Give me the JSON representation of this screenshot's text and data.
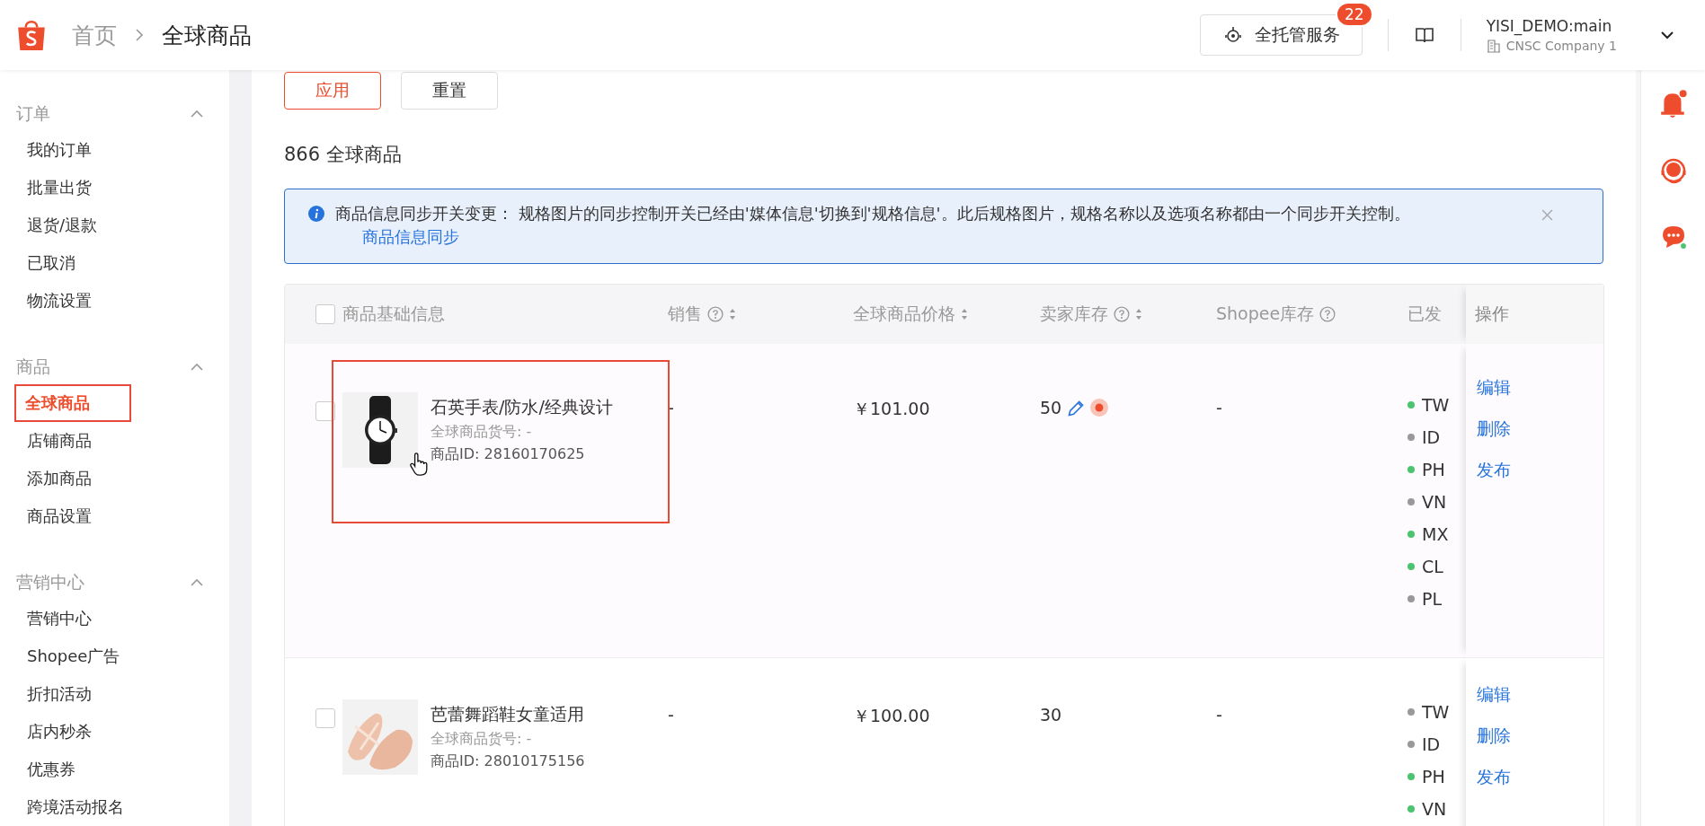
{
  "header": {
    "breadcrumb": [
      {
        "label": "首页",
        "current": false
      },
      {
        "label": "全球商品",
        "current": true
      }
    ],
    "service_button": {
      "label": "全托管服务",
      "badge": "22"
    },
    "account": {
      "name": "YISI_DEMO:main",
      "company": "CNSC Company 1"
    }
  },
  "sidebar": [
    {
      "title": "订单",
      "expanded": true,
      "items": [
        {
          "label": "我的订单",
          "selected": false
        },
        {
          "label": "批量出货",
          "selected": false
        },
        {
          "label": "退货/退款",
          "selected": false
        },
        {
          "label": "已取消",
          "selected": false
        },
        {
          "label": "物流设置",
          "selected": false
        }
      ]
    },
    {
      "title": "商品",
      "expanded": true,
      "items": [
        {
          "label": "全球商品",
          "selected": true
        },
        {
          "label": "店铺商品",
          "selected": false
        },
        {
          "label": "添加商品",
          "selected": false
        },
        {
          "label": "商品设置",
          "selected": false
        }
      ]
    },
    {
      "title": "营销中心",
      "expanded": true,
      "items": [
        {
          "label": "营销中心",
          "selected": false
        },
        {
          "label": "Shopee广告",
          "selected": false
        },
        {
          "label": "折扣活动",
          "selected": false
        },
        {
          "label": "店内秒杀",
          "selected": false
        },
        {
          "label": "优惠券",
          "selected": false
        },
        {
          "label": "跨境活动报名",
          "selected": false
        }
      ]
    }
  ],
  "filter_buttons": [
    {
      "label": "应用",
      "kind": "primary"
    },
    {
      "label": "重置",
      "kind": "default"
    }
  ],
  "count": {
    "number": "866",
    "label": "全球商品"
  },
  "notice": {
    "text": "商品信息同步开关变更： 规格图片的同步控制开关已经由'媒体信息'切换到'规格信息'。此后规格图片，规格名称以及选项名称都由一个同步开关控制。",
    "link": "商品信息同步"
  },
  "table": {
    "select_all_checked": false,
    "columns": [
      {
        "label": "商品基础信息",
        "kind": "plain"
      },
      {
        "label": "销售",
        "kind": "help_sort"
      },
      {
        "label": "全球商品价格",
        "kind": "sort"
      },
      {
        "label": "卖家库存",
        "kind": "help_sort"
      },
      {
        "label": "Shopee库存",
        "kind": "help"
      },
      {
        "label": "已发",
        "kind": "plain"
      },
      {
        "label": "操作",
        "kind": "plain"
      }
    ],
    "rows": [
      {
        "name": "石英手表/防水/经典设计",
        "sku": "全球商品货号: -",
        "id": "商品ID: 28160170625",
        "checked": false,
        "highlighted": true,
        "sales": "-",
        "price": "￥101.00",
        "stock": "50",
        "stock_editable": true,
        "shopee_stock": "-",
        "regions": [
          {
            "code": "TW",
            "color": "#4cc46f"
          },
          {
            "code": "ID",
            "color": "#999999"
          },
          {
            "code": "PH",
            "color": "#4cc46f"
          },
          {
            "code": "VN",
            "color": "#999999"
          },
          {
            "code": "MX",
            "color": "#4cc46f"
          },
          {
            "code": "CL",
            "color": "#4cc46f"
          },
          {
            "code": "PL",
            "color": "#999999"
          }
        ],
        "actions": [
          "编辑",
          "删除",
          "发布"
        ]
      },
      {
        "name": "芭蕾舞蹈鞋女童适用",
        "sku": "全球商品货号: -",
        "id": "商品ID: 28010175156",
        "checked": false,
        "highlighted": false,
        "sales": "-",
        "price": "￥100.00",
        "stock": "30",
        "stock_editable": false,
        "shopee_stock": "-",
        "regions": [
          {
            "code": "TW",
            "color": "#999999"
          },
          {
            "code": "ID",
            "color": "#999999"
          },
          {
            "code": "PH",
            "color": "#4cc46f"
          },
          {
            "code": "VN",
            "color": "#4cc46f"
          }
        ],
        "actions": [
          "编辑",
          "删除",
          "发布"
        ]
      }
    ]
  }
}
